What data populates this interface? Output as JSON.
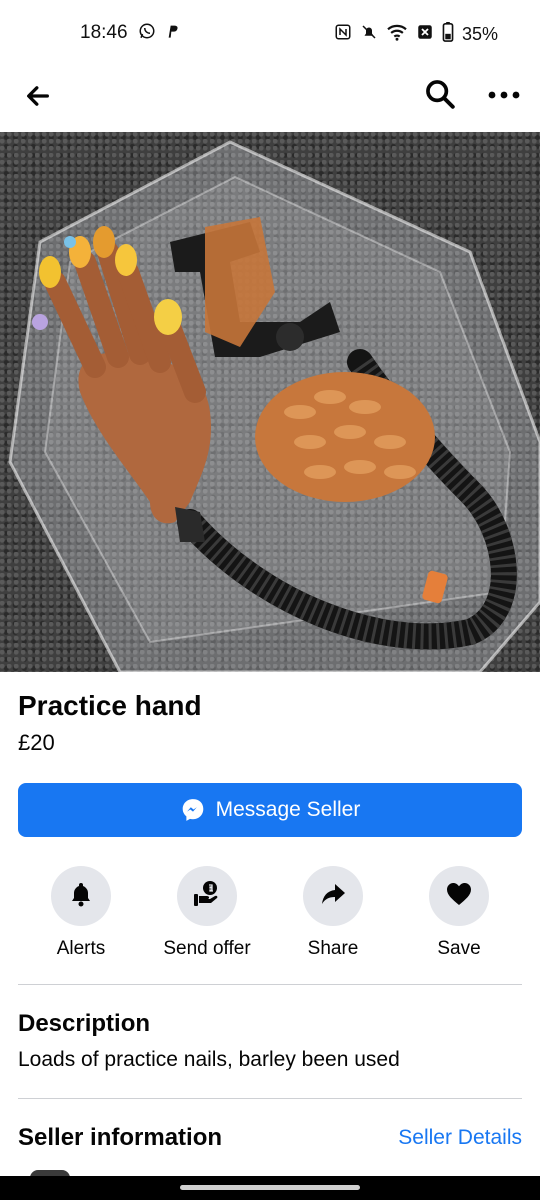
{
  "status_bar": {
    "time": "18:46",
    "left_icons": [
      "whatsapp-icon",
      "paypal-icon"
    ],
    "right_icons": [
      "nfc-icon",
      "bell-off-icon",
      "wifi-icon",
      "sim-off-icon",
      "battery-icon"
    ],
    "battery_percent": "35%"
  },
  "app_bar": {
    "back_icon": "arrow-left-icon",
    "search_icon": "search-icon",
    "more_icon": "more-horizontal-icon"
  },
  "listing": {
    "photo_count": 2,
    "active_photo_index": 0,
    "title": "Practice hand",
    "price": "£20"
  },
  "message_button": {
    "label": "Message Seller",
    "icon": "messenger-icon",
    "color": "#1877f2"
  },
  "actions": [
    {
      "label": "Alerts",
      "icon": "bell-icon"
    },
    {
      "label": "Send offer",
      "icon": "offer-hand-icon"
    },
    {
      "label": "Share",
      "icon": "share-arrow-icon"
    },
    {
      "label": "Save",
      "icon": "heart-icon"
    }
  ],
  "description": {
    "heading": "Description",
    "text": "Loads of practice nails, barley been used"
  },
  "seller": {
    "heading": "Seller information",
    "link": "Seller Details"
  }
}
